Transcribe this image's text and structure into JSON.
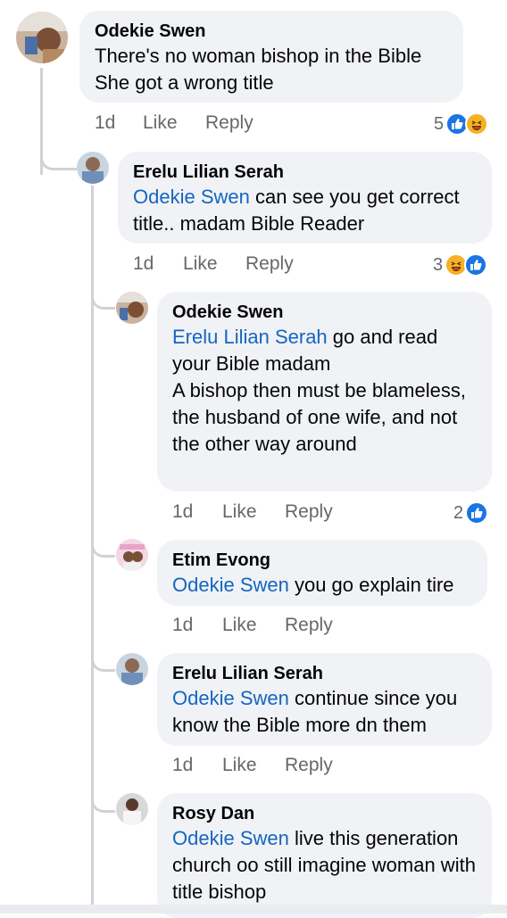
{
  "comments": [
    {
      "author": "Odekie Swen",
      "mention": "",
      "text_lines": [
        "There's no woman bishop in the Bible",
        "She got a wrong title"
      ],
      "time": "1d",
      "like": "Like",
      "reply": "Reply",
      "reaction_count": "5",
      "reactions": [
        "like-icon",
        "haha-icon"
      ]
    },
    {
      "author": "Erelu Lilian Serah",
      "mention": "Odekie Swen",
      "text": " can see you get correct title.. madam Bible Reader",
      "time": "1d",
      "like": "Like",
      "reply": "Reply",
      "reaction_count": "3",
      "reactions": [
        "haha-icon",
        "like-icon"
      ]
    },
    {
      "author": "Odekie Swen",
      "mention": "Erelu Lilian Serah",
      "text": " go and read your Bible madam",
      "text_extra": "A bishop then must be blameless, the husband of one wife, and not the other way around",
      "time": "1d",
      "like": "Like",
      "reply": "Reply",
      "reaction_count": "2",
      "reactions": [
        "like-icon"
      ]
    },
    {
      "author": "Etim Evong",
      "mention": "Odekie Swen",
      "text": " you go explain tire",
      "time": "1d",
      "like": "Like",
      "reply": "Reply"
    },
    {
      "author": "Erelu Lilian Serah",
      "mention": "Odekie Swen",
      "text": " continue since you know the Bible more dn them",
      "time": "1d",
      "like": "Like",
      "reply": "Reply"
    },
    {
      "author": "Rosy Dan",
      "mention": "Odekie Swen",
      "text": " live this generation church oo still imagine woman with title bishop"
    }
  ],
  "colors": {
    "like": "#1b74e4",
    "haha": "#f7b125",
    "mention": "#1565c0",
    "bubble": "#f0f2f5"
  }
}
